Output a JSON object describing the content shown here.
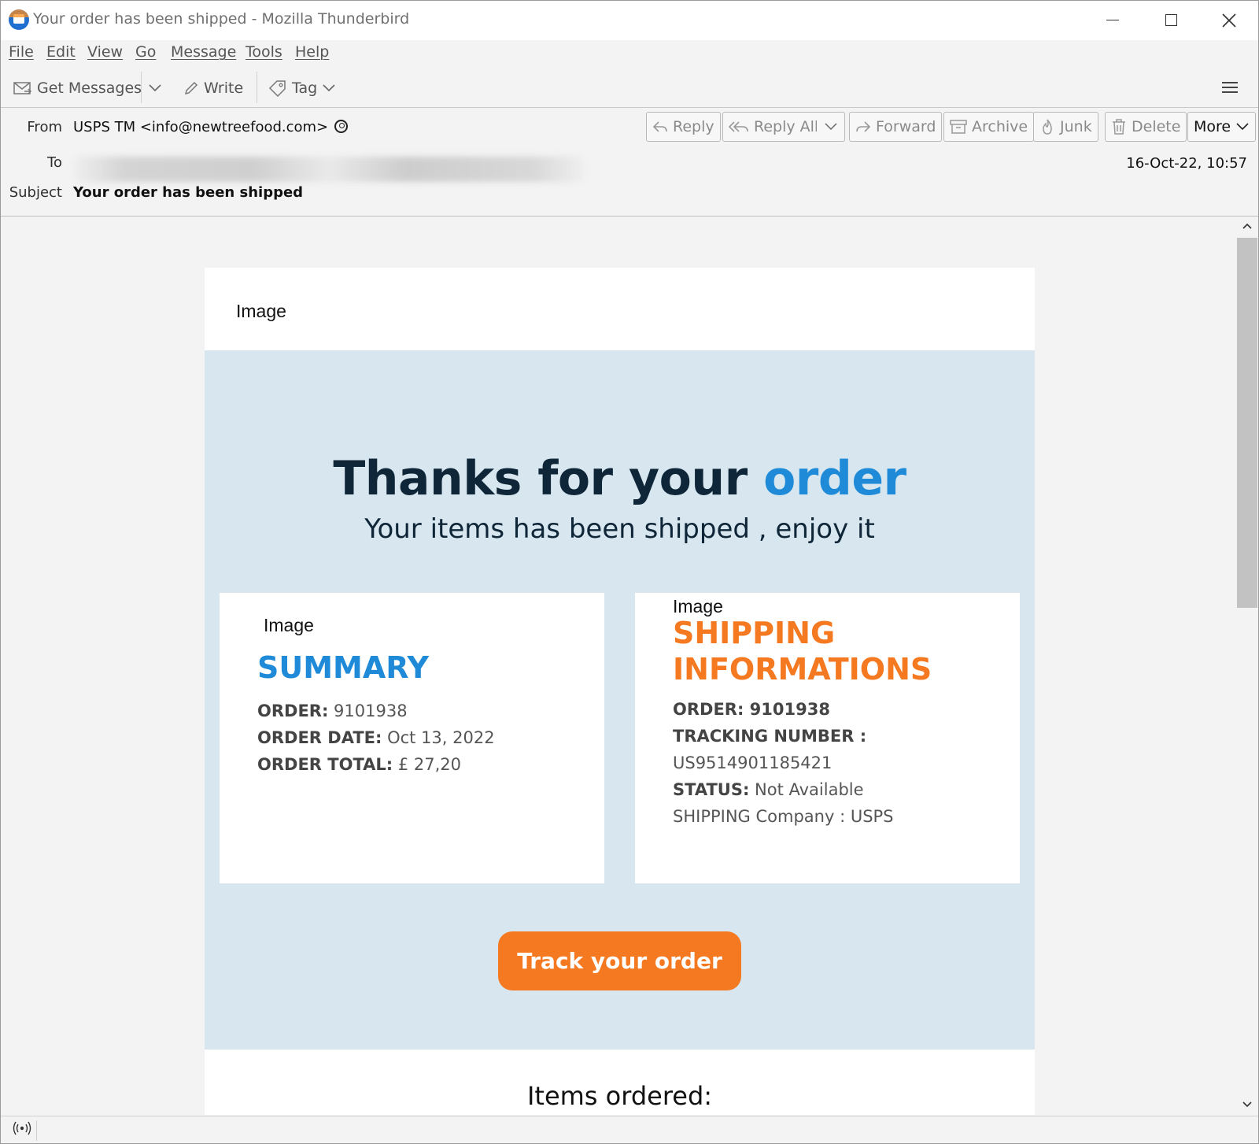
{
  "window": {
    "title": "Your order has been shipped - Mozilla Thunderbird"
  },
  "menubar": {
    "items": [
      "File",
      "Edit",
      "View",
      "Go",
      "Message",
      "Tools",
      "Help"
    ]
  },
  "toolbar": {
    "get_messages": "Get Messages",
    "write": "Write",
    "tag": "Tag"
  },
  "header": {
    "from_label": "From",
    "from_value": "USPS TM <info@newtreefood.com>",
    "to_label": "To",
    "subject_label": "Subject",
    "subject_value": "Your order has been shipped",
    "date": "16-Oct-22, 10:57",
    "actions": {
      "reply": "Reply",
      "reply_all": "Reply All",
      "forward": "Forward",
      "archive": "Archive",
      "junk": "Junk",
      "delete": "Delete",
      "more": "More"
    }
  },
  "email": {
    "top_image_alt": "Image",
    "hero_title_part1": "Thanks for your ",
    "hero_title_accent": "order",
    "hero_subtitle": "Your items has been shipped , enjoy it",
    "summary": {
      "image_alt": "Image",
      "heading": "SUMMARY",
      "order_label": "ORDER:",
      "order_value": " 9101938",
      "order_date_label": "ORDER DATE:",
      "order_date_value": " Oct 13, 2022",
      "order_total_label": "ORDER TOTAL:",
      "order_total_value": " £ 27,20"
    },
    "shipping": {
      "image_alt": "Image",
      "heading_line1": "SHIPPING",
      "heading_line2": "INFORMATIONS",
      "order_label": "ORDER: 9101938",
      "tracking_label": "TRACKING NUMBER :",
      "tracking_value": "US9514901185421",
      "status_label": "STATUS:",
      "status_value": " Not Available",
      "company": "SHIPPING Company : USPS"
    },
    "track_button": "Track your order",
    "items_title": "Items ordered:"
  },
  "colors": {
    "hero_bg": "#d8e7ef",
    "accent_blue": "#1f8bd8",
    "accent_orange": "#f47920",
    "dark_navy": "#0f2638"
  }
}
